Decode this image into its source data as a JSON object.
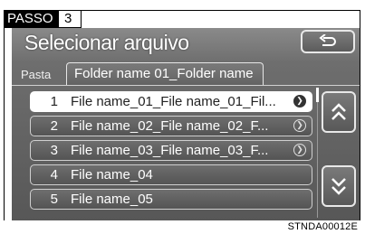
{
  "step": {
    "label": "PASSO",
    "number": "3"
  },
  "screen": {
    "title": "Selecionar arquivo",
    "back_icon": "back-arrow-icon",
    "tab_label": "Pasta",
    "folder_name": "Folder name 01_Folder name",
    "files": [
      {
        "num": "1",
        "name": "File name_01_File name_01_Fil...",
        "selected": true,
        "has_arrow": true
      },
      {
        "num": "2",
        "name": "File name_02_File name_02_F...",
        "selected": false,
        "has_arrow": true
      },
      {
        "num": "3",
        "name": "File name_03_File name_03_F...",
        "selected": false,
        "has_arrow": true
      },
      {
        "num": "4",
        "name": "File name_04",
        "selected": false,
        "has_arrow": false
      },
      {
        "num": "5",
        "name": "File name_05",
        "selected": false,
        "has_arrow": false
      }
    ],
    "scroll_up_icon": "double-chevron-up-icon",
    "scroll_down_icon": "double-chevron-down-icon"
  },
  "caption": "STNDA00012E"
}
